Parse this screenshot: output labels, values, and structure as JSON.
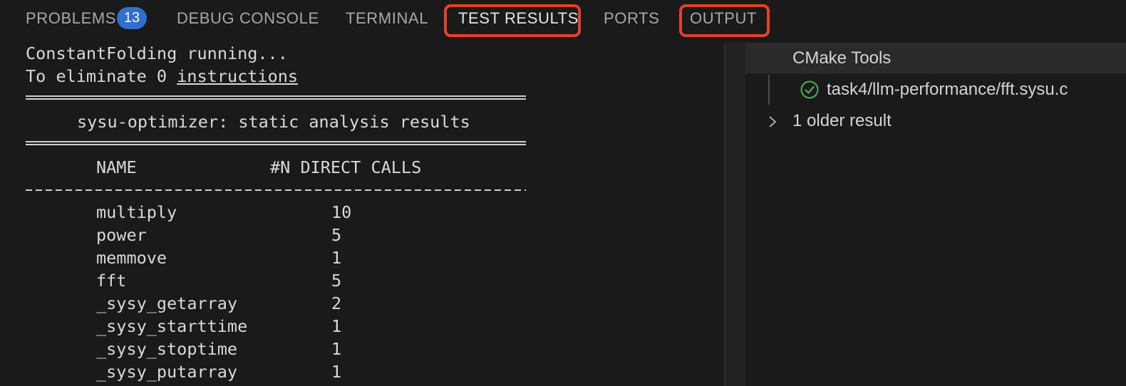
{
  "tabs": {
    "problems": "PROBLEMS",
    "problems_count": "13",
    "debug_console": "DEBUG CONSOLE",
    "terminal": "TERMINAL",
    "test_results": "TEST RESULTS",
    "ports": "PORTS",
    "output": "OUTPUT"
  },
  "highlighted_tabs": [
    "TEST RESULTS",
    "OUTPUT"
  ],
  "output_log": {
    "line1": "ConstantFolding running...",
    "line2_prefix": "To eliminate 0 ",
    "line2_link": "instructions",
    "title": "sysu-optimizer: static analysis results",
    "col_name": "NAME",
    "col_calls": "#N DIRECT CALLS",
    "rows": [
      {
        "name": "multiply",
        "calls": "10"
      },
      {
        "name": "power",
        "calls": "5"
      },
      {
        "name": "memmove",
        "calls": "1"
      },
      {
        "name": "fft",
        "calls": "5"
      },
      {
        "name": "_sysy_getarray",
        "calls": "2"
      },
      {
        "name": "_sysy_starttime",
        "calls": "1"
      },
      {
        "name": "_sysy_stoptime",
        "calls": "1"
      },
      {
        "name": "_sysy_putarray",
        "calls": "1"
      }
    ]
  },
  "test_panel": {
    "title": "CMake Tools",
    "result_label": "task4/llm-performance/fft.sysu.c",
    "result_status_icon": "check-circle-icon",
    "older_label": "1 older result",
    "older_icon": "chevron-right-icon"
  },
  "colors": {
    "background": "#1a1a1a",
    "badge": "#2f6fd0",
    "highlight": "#e5402b",
    "pass": "#4fae5a"
  }
}
